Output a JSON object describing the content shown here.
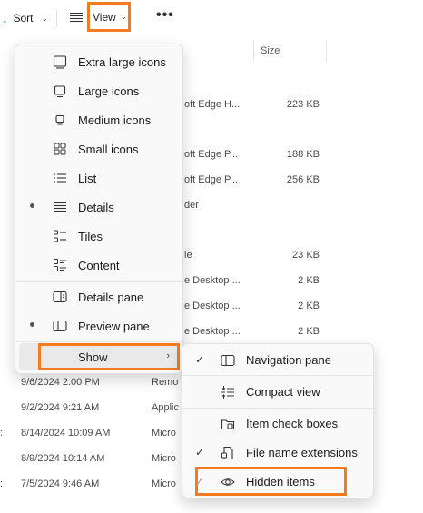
{
  "toolbar": {
    "sort_label": "Sort",
    "view_label": "View",
    "more_label": "•••"
  },
  "file_list": {
    "size_header": "Size",
    "upper_rows": [
      {
        "type": "oft Edge H...",
        "size": "223 KB"
      },
      {
        "type": "oft Edge P...",
        "size": "188 KB"
      },
      {
        "type": "oft Edge P...",
        "size": "256 KB"
      },
      {
        "type": "der",
        "size": ""
      },
      {
        "type": "le",
        "size": "23 KB"
      },
      {
        "type": "e Desktop ...",
        "size": "2 KB"
      },
      {
        "type": "e Desktop ...",
        "size": "2 KB"
      },
      {
        "type": "e Desktop ...",
        "size": "2 KB"
      }
    ],
    "lower_rows": [
      {
        "date": "9/6/2024 2:00 PM",
        "type": "Remo",
        "lead": ""
      },
      {
        "date": "9/2/2024 9:21 AM",
        "type": "Applic",
        "lead": ""
      },
      {
        "date": "8/14/2024 10:09 AM",
        "type": "Micro",
        "lead": ":"
      },
      {
        "date": "8/9/2024 10:14 AM",
        "type": "Micro",
        "lead": ""
      },
      {
        "date": "7/5/2024 9:46 AM",
        "type": "Micro",
        "lead": ":"
      }
    ]
  },
  "view_menu": {
    "items": [
      {
        "label": "Extra large icons",
        "icon": "extra-large-icons-icon",
        "selected": false
      },
      {
        "label": "Large icons",
        "icon": "large-icons-icon",
        "selected": false
      },
      {
        "label": "Medium icons",
        "icon": "medium-icons-icon",
        "selected": false
      },
      {
        "label": "Small icons",
        "icon": "small-icons-icon",
        "selected": false
      },
      {
        "label": "List",
        "icon": "list-icon",
        "selected": false
      },
      {
        "label": "Details",
        "icon": "details-icon",
        "selected": true
      },
      {
        "label": "Tiles",
        "icon": "tiles-icon",
        "selected": false
      },
      {
        "label": "Content",
        "icon": "content-icon",
        "selected": false
      },
      {
        "label": "Details pane",
        "icon": "details-pane-icon",
        "selected": false
      },
      {
        "label": "Preview pane",
        "icon": "preview-pane-icon",
        "selected": true
      },
      {
        "label": "Show",
        "icon": "",
        "selected": false
      }
    ]
  },
  "show_submenu": {
    "items": [
      {
        "label": "Navigation pane",
        "icon": "navigation-pane-icon",
        "checked": true
      },
      {
        "label": "Compact view",
        "icon": "compact-view-icon",
        "checked": false
      },
      {
        "label": "Item check boxes",
        "icon": "item-check-boxes-icon",
        "checked": false
      },
      {
        "label": "File name extensions",
        "icon": "file-name-extensions-icon",
        "checked": true
      },
      {
        "label": "Hidden items",
        "icon": "hidden-items-icon",
        "checked": true
      }
    ]
  },
  "colors": {
    "highlight": "#f47a20",
    "menu_bg": "#f9f9f9",
    "accent": "#1b6fd1"
  }
}
